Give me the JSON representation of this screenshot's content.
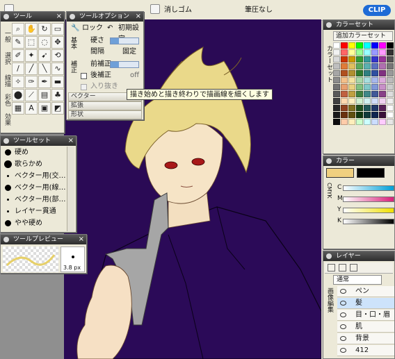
{
  "topbar": {
    "eraser_label": "消しゴム",
    "pressure_label": "筆圧なし",
    "logo_text": "CLIP"
  },
  "tool_palette": {
    "title": "ツール",
    "categories": [
      "一般",
      "選択",
      "線描",
      "彩色",
      "効果"
    ]
  },
  "tool_options": {
    "title": "ツールオプション",
    "lock_label": "ロック",
    "reset_label": "初期設定",
    "side_basic": "基本",
    "side_correction": "補正",
    "hardness_label": "硬さ",
    "spacing_label": "間隔",
    "spacing_value": "固定",
    "pre_correction_label": "前補正",
    "post_correction_label": "後補正",
    "post_correction_value": "off",
    "taper_label": "入り抜き",
    "vector_label": "ベクター",
    "extend_label": "拡張",
    "shape_label": "形状"
  },
  "tooltip": {
    "text": "描き始めと描き終わりで描画線を細くします"
  },
  "brush_set": {
    "title": "ツールセット",
    "items": [
      "硬め",
      "歌らかめ",
      "ベクター用(交…",
      "ベクター用(線…",
      "ベクター用(部…",
      "レイヤー貫通",
      "やや硬め"
    ]
  },
  "preview": {
    "title": "ツールプレビュー",
    "size_label": "3.8 px"
  },
  "color_set": {
    "title": "カラーセット",
    "add_button": "追加カラーセット",
    "side_label": "カラーセット",
    "colors": [
      "#ffffff",
      "#ff0000",
      "#ffff00",
      "#00ff00",
      "#00ffff",
      "#0000ff",
      "#ff00ff",
      "#000000",
      "#f2f2f2",
      "#ff6666",
      "#ffff99",
      "#99ff99",
      "#99ffff",
      "#9999ff",
      "#ff99ff",
      "#333333",
      "#d9d9d9",
      "#cc3300",
      "#cc9900",
      "#339933",
      "#339999",
      "#3333cc",
      "#993399",
      "#555555",
      "#bfbfbf",
      "#e07b39",
      "#e0c060",
      "#5caa5c",
      "#5cb0b0",
      "#5c70c0",
      "#b070b0",
      "#777777",
      "#a6a6a6",
      "#b05020",
      "#b09030",
      "#2f7a2f",
      "#2f8080",
      "#2f4fa0",
      "#803080",
      "#999999",
      "#8c8c8c",
      "#f4c08a",
      "#f4e2a0",
      "#a8d8a8",
      "#a8dede",
      "#a8b8ec",
      "#dcaadc",
      "#bbbbbb",
      "#737373",
      "#e8a070",
      "#e8d080",
      "#80c080",
      "#80c8c8",
      "#8098d8",
      "#c890c8",
      "#cccccc",
      "#595959",
      "#c06040",
      "#c0a040",
      "#408040",
      "#408888",
      "#405898",
      "#884088",
      "#dddddd",
      "#404040",
      "#ffd8b0",
      "#fff0c0",
      "#d0f0d0",
      "#d0f0f0",
      "#d0dcf8",
      "#f0d0f0",
      "#eeeeee",
      "#262626",
      "#904020",
      "#807020",
      "#205020",
      "#205858",
      "#203868",
      "#582058",
      "#f8f8f8",
      "#1a1a1a",
      "#6a3010",
      "#605010",
      "#103810",
      "#103a3a",
      "#102450",
      "#3a103a",
      "#ffffff",
      "#0d0d0d",
      "#ffccaa",
      "#ffeebb",
      "#ccffcc",
      "#ccffff",
      "#ccddff",
      "#ffccff",
      "#e6e6e6"
    ]
  },
  "color": {
    "title": "カラー",
    "main_color": "#f0d080",
    "sub_color": "#000000",
    "side_label": "CMYK",
    "channels": [
      "C",
      "M",
      "Y",
      "K"
    ]
  },
  "layer": {
    "title": "レイヤー",
    "mode": "通常",
    "side_label": "画像編集",
    "rows": [
      "ペン",
      "髪",
      "目・口・眉",
      "肌",
      "背景",
      "412"
    ]
  }
}
